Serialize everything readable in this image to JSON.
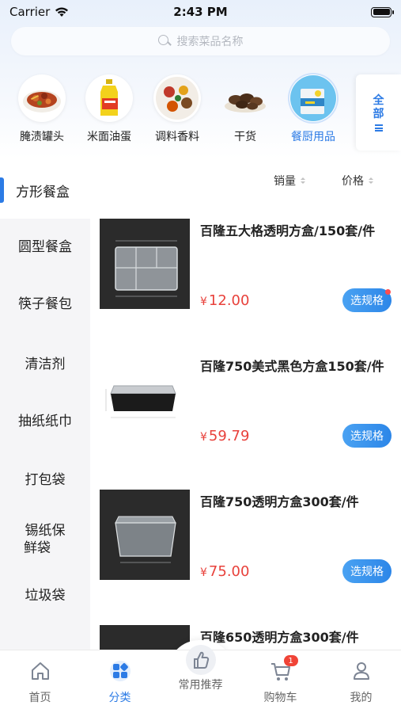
{
  "status_bar": {
    "carrier": "Carrier",
    "time": "2:43 PM"
  },
  "search": {
    "placeholder": "搜索菜品名称"
  },
  "categories": [
    {
      "label": "腌渍罐头",
      "icon": "pickled-food-icon",
      "active": false
    },
    {
      "label": "米面油蛋",
      "icon": "oil-bottle-icon",
      "active": false
    },
    {
      "label": "调料香料",
      "icon": "spices-icon",
      "active": false
    },
    {
      "label": "干货",
      "icon": "dried-goods-icon",
      "active": false
    },
    {
      "label": "餐厨用品",
      "icon": "kitchen-supplies-icon",
      "active": true
    }
  ],
  "all_button": {
    "line1": "全",
    "line2": "部"
  },
  "sidebar": {
    "active": "方形餐盒",
    "items": [
      "圆型餐盒",
      "筷子餐包",
      "清洁剂",
      "抽纸纸巾",
      "打包袋",
      "锡纸保",
      "鲜袋",
      "垃圾袋"
    ]
  },
  "sort": {
    "sales": "销量",
    "price": "价格"
  },
  "currency": "¥",
  "spec_label": "选规格",
  "products": [
    {
      "title": "百隆五大格透明方盒/150套/件",
      "price": "12.00"
    },
    {
      "title": "百隆750美式黑色方盒150套/件",
      "price": "59.79"
    },
    {
      "title": "百隆750透明方盒300套/件",
      "price": "75.00"
    },
    {
      "title": "百隆650透明方盒300套/件",
      "price": ""
    }
  ],
  "tabs": [
    {
      "label": "首页",
      "icon": "home-icon"
    },
    {
      "label": "分类",
      "icon": "category-icon"
    },
    {
      "label": "常用推荐",
      "icon": "thumbs-up-icon"
    },
    {
      "label": "购物车",
      "icon": "cart-icon",
      "badge": "1"
    },
    {
      "label": "我的",
      "icon": "profile-icon"
    }
  ],
  "colors": {
    "accent": "#2c7be5",
    "price": "#e8413b",
    "badge": "#f04437"
  }
}
